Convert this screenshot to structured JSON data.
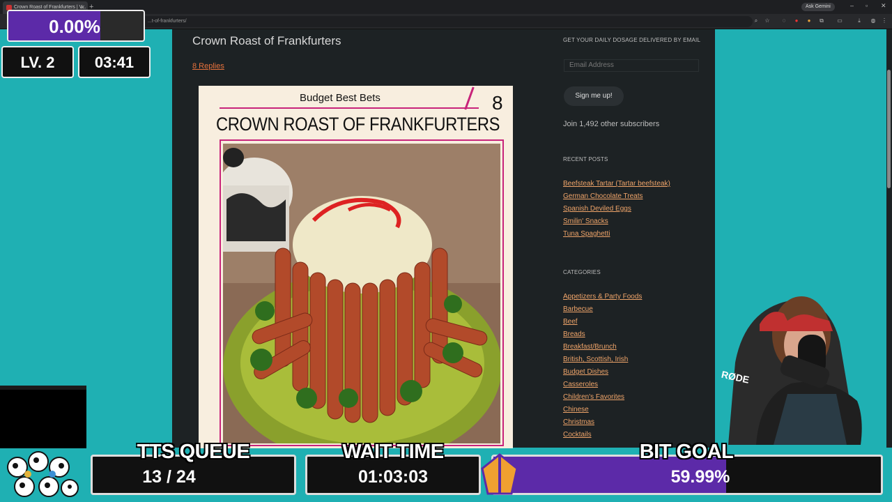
{
  "browser": {
    "tab_title": "Crown Roast of Frankfurters | V...",
    "url": "...t-of-frankfurters/",
    "ask_gemini": "Ask Gemini",
    "new_tab": "+"
  },
  "post": {
    "title": "Crown Roast of Frankfurters",
    "replies": "8 Replies",
    "card": {
      "series": "Budget Best Bets",
      "number": "8",
      "title": "CROWN ROAST OF FRANKFURTERS"
    }
  },
  "sidebar": {
    "email_heading": "GET YOUR DAILY DOSAGE DELIVERED BY EMAIL",
    "email_placeholder": "Email Address",
    "signup_label": "Sign me up!",
    "subscribers": "Join 1,492 other subscribers",
    "recent_heading": "RECENT POSTS",
    "recent_posts": [
      "Beefsteak Tartar (Tartar beefsteak)",
      "German Chocolate Treats",
      "Spanish Deviled Eggs",
      "Smilin' Snacks",
      "Tuna Spaghetti"
    ],
    "categories_heading": "CATEGORIES",
    "categories": [
      "Appetizers & Party Foods",
      "Barbecue",
      "Beef",
      "Breads",
      "Breakfast/Brunch",
      "British, Scottish, Irish",
      "Budget Dishes",
      "Casseroles",
      "Children's Favorites",
      "Chinese",
      "Christmas",
      "Cocktails"
    ]
  },
  "overlay": {
    "progress_text": "0.00%",
    "progress_value": 0.0,
    "level": "LV. 2",
    "timer": "03:41",
    "tts_label": "TTS QUEUE",
    "tts_value": "13 / 24",
    "wait_label": "WAIT TIME",
    "wait_value": "01:03:03",
    "bit_label": "BIT GOAL",
    "bit_value": "59.99%",
    "bit_progress": 0.5999,
    "mic_brand": "RØDE"
  },
  "colors": {
    "page_bg": "#1fb0b3",
    "content_bg": "#1d2224",
    "link": "#f0a56a",
    "accent_purple": "#5c2aa8",
    "card_magenta": "#c8237a"
  }
}
